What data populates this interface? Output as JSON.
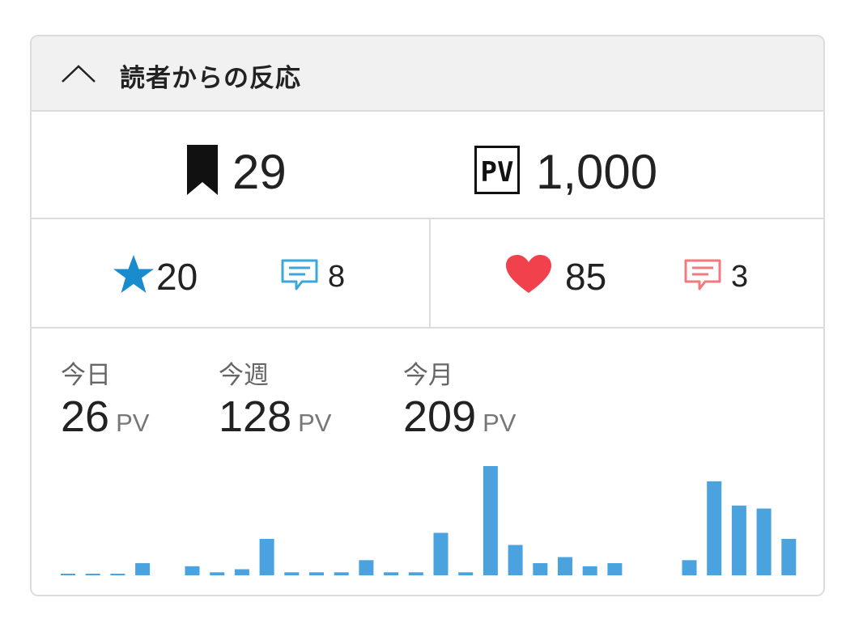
{
  "header": {
    "title": "読者からの反応",
    "toggle_icon": "chevron-up-icon"
  },
  "totals": {
    "bookmarks": {
      "icon": "bookmark-icon",
      "value": "29"
    },
    "pageviews": {
      "icon": "pv-icon",
      "icon_text": "PV",
      "value": "1,000"
    }
  },
  "reactions": {
    "stars": {
      "icon": "star-icon",
      "value": "20",
      "color": "#1a8ccd"
    },
    "star_comments": {
      "icon": "comment-icon",
      "value": "8",
      "color": "#3da7d9"
    },
    "hearts": {
      "icon": "heart-icon",
      "value": "85",
      "color": "#f0414c"
    },
    "heart_comments": {
      "icon": "comment-icon",
      "value": "3",
      "color": "#f07a7f"
    }
  },
  "pv_stats": {
    "today": {
      "label": "今日",
      "value": "26",
      "unit": "PV"
    },
    "week": {
      "label": "今週",
      "value": "128",
      "unit": "PV"
    },
    "month": {
      "label": "今月",
      "value": "209",
      "unit": "PV"
    }
  },
  "chart_data": {
    "type": "bar",
    "color": "#4aa3df",
    "values": [
      0,
      0,
      0,
      4,
      null,
      3,
      1,
      2,
      12,
      1,
      1,
      1,
      5,
      1,
      1,
      14,
      1,
      36,
      10,
      4,
      6,
      3,
      4,
      null,
      null,
      5,
      31,
      23,
      22,
      12
    ],
    "ylim": [
      0,
      36
    ]
  }
}
